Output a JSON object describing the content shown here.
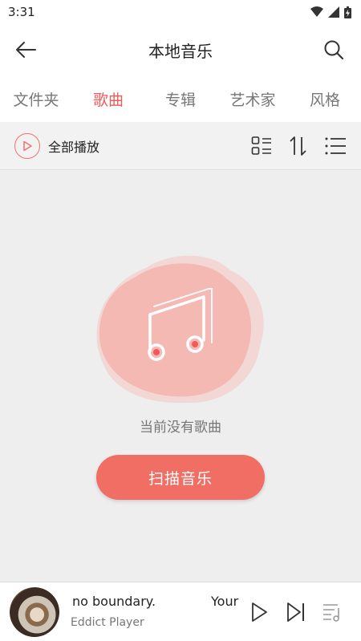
{
  "status": {
    "time": "3:31"
  },
  "header": {
    "title": "本地音乐"
  },
  "tabs": [
    {
      "label": "文件夹",
      "active": false
    },
    {
      "label": "歌曲",
      "active": true
    },
    {
      "label": "专辑",
      "active": false
    },
    {
      "label": "艺术家",
      "active": false
    },
    {
      "label": "风格",
      "active": false
    }
  ],
  "toolbar": {
    "play_all_label": "全部播放"
  },
  "empty": {
    "message": "当前没有歌曲",
    "scan_button": "扫描音乐"
  },
  "player": {
    "title": "no boundary.",
    "title_next": "Your",
    "artist": "Eddict Player"
  },
  "colors": {
    "accent": "#f05a5a",
    "button": "#f06e64",
    "blob": "#f4b9b3"
  }
}
